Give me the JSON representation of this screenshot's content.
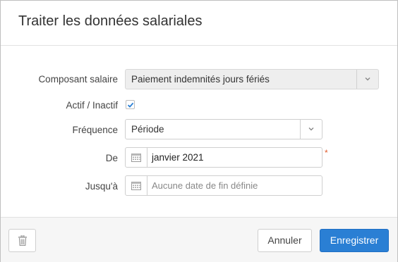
{
  "dialog": {
    "title": "Traiter les données salariales"
  },
  "form": {
    "component": {
      "label": "Composant salaire",
      "value": "Paiement indemnités jours fériés"
    },
    "active": {
      "label": "Actif / Inactif",
      "checked": true
    },
    "frequency": {
      "label": "Fréquence",
      "value": "Période"
    },
    "from": {
      "label": "De",
      "value": "janvier 2021",
      "required_mark": "*"
    },
    "to": {
      "label": "Jusqu'à",
      "placeholder": "Aucune date de fin définie"
    }
  },
  "footer": {
    "cancel_label": "Annuler",
    "save_label": "Enregistrer"
  },
  "colors": {
    "primary": "#2a7fd4",
    "required": "#e05a2b",
    "checkbox": "#2a7fd4"
  },
  "icons": {
    "delete": "trash-icon",
    "calendar": "calendar-icon",
    "dropdown": "chevron-down-icon",
    "check": "check-icon"
  }
}
